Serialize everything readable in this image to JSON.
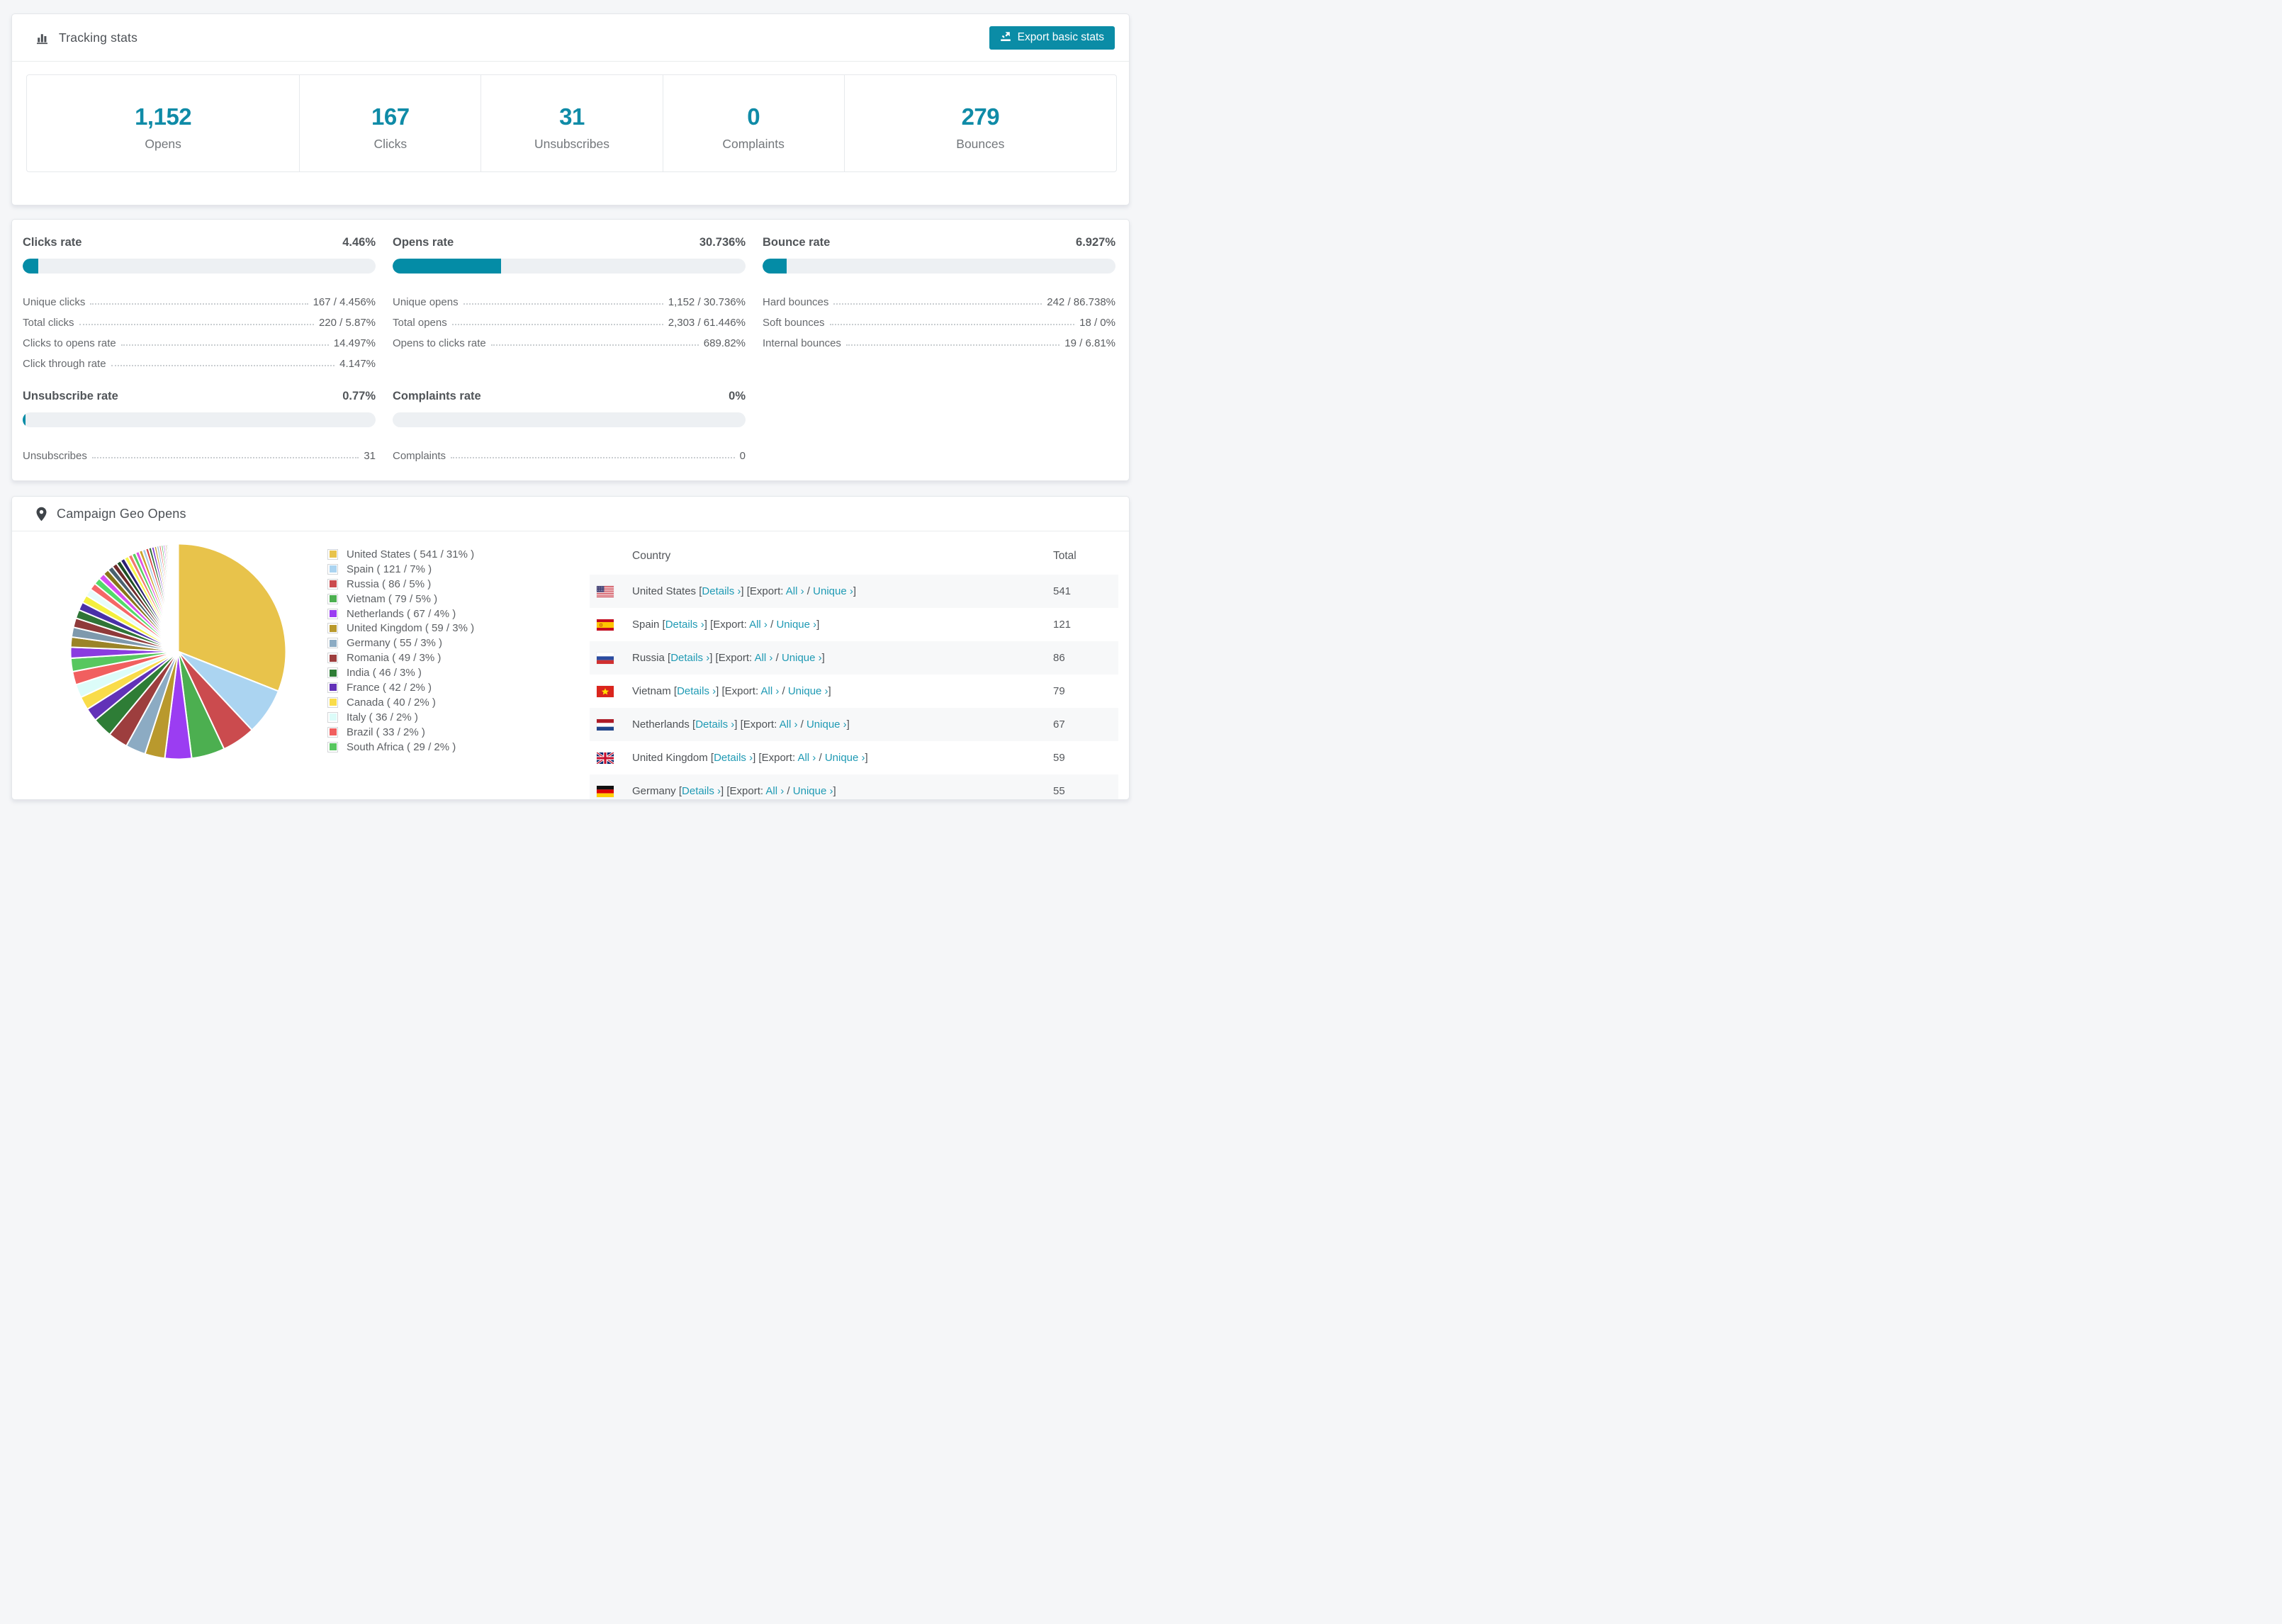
{
  "colors": {
    "accent_teal": "#0b8ca6",
    "stat_number": "#0f8ba7",
    "bar_fill": "#048ca6",
    "bar_track": "#edf0f3",
    "link": "#1f9ab4",
    "row_stripe": "#f7f8f9",
    "card_border": "#e4e7ea",
    "page_bg": "#f5f6f8"
  },
  "tracking_stats": {
    "title": "Tracking stats",
    "export_button_label": "Export basic stats",
    "stats": [
      {
        "value": "1,152",
        "label": "Opens"
      },
      {
        "value": "167",
        "label": "Clicks"
      },
      {
        "value": "31",
        "label": "Unsubscribes"
      },
      {
        "value": "0",
        "label": "Complaints"
      },
      {
        "value": "279",
        "label": "Bounces"
      }
    ]
  },
  "rates": {
    "sections": [
      {
        "title": "Clicks rate",
        "value": "4.46%",
        "pct": 4.46,
        "rows": [
          {
            "label": "Unique clicks",
            "value": "167 / 4.456%"
          },
          {
            "label": "Total clicks",
            "value": "220 / 5.87%"
          },
          {
            "label": "Clicks to opens rate",
            "value": "14.497%"
          },
          {
            "label": "Click through rate",
            "value": "4.147%"
          }
        ]
      },
      {
        "title": "Opens rate",
        "value": "30.736%",
        "pct": 30.736,
        "rows": [
          {
            "label": "Unique opens",
            "value": "1,152 / 30.736%"
          },
          {
            "label": "Total opens",
            "value": "2,303 / 61.446%"
          },
          {
            "label": "Opens to clicks rate",
            "value": "689.82%"
          }
        ]
      },
      {
        "title": "Bounce rate",
        "value": "6.927%",
        "pct": 6.927,
        "rows": [
          {
            "label": "Hard bounces",
            "value": "242 / 86.738%"
          },
          {
            "label": "Soft bounces",
            "value": "18 / 0%"
          },
          {
            "label": "Internal bounces",
            "value": "19 / 6.81%"
          }
        ]
      },
      {
        "title": "Unsubscribe rate",
        "value": "0.77%",
        "pct": 0.77,
        "rows": [
          {
            "label": "Unsubscribes",
            "value": "31"
          }
        ]
      },
      {
        "title": "Complaints rate",
        "value": "0%",
        "pct": 0,
        "rows": [
          {
            "label": "Complaints",
            "value": "0"
          }
        ]
      }
    ]
  },
  "geo": {
    "title": "Campaign Geo Opens",
    "table": {
      "header_country": "Country",
      "header_total": "Total",
      "details_label": "Details ›",
      "export_prefix": "Export:",
      "all_label": "All ›",
      "unique_label": "Unique ›",
      "rows": [
        {
          "country": "United States",
          "flag": "us",
          "total": "541"
        },
        {
          "country": "Spain",
          "flag": "es",
          "total": "121"
        },
        {
          "country": "Russia",
          "flag": "ru",
          "total": "86"
        },
        {
          "country": "Vietnam",
          "flag": "vn",
          "total": "79"
        },
        {
          "country": "Netherlands",
          "flag": "nl",
          "total": "67"
        },
        {
          "country": "United Kingdom",
          "flag": "gb",
          "total": "59"
        },
        {
          "country": "Germany",
          "flag": "de",
          "total": "55"
        }
      ]
    }
  },
  "chart_data": {
    "type": "pie",
    "title": "Campaign Geo Opens",
    "legend_position": "right",
    "legend_format": "{name} ( {value} / {pct}% )",
    "series": [
      {
        "name": "United States",
        "value": 541,
        "pct": 31,
        "color": "#e8c34b"
      },
      {
        "name": "Spain",
        "value": 121,
        "pct": 7,
        "color": "#abd4f1"
      },
      {
        "name": "Russia",
        "value": 86,
        "pct": 5,
        "color": "#cb4b4e"
      },
      {
        "name": "Vietnam",
        "value": 79,
        "pct": 5,
        "color": "#4caf50"
      },
      {
        "name": "Netherlands",
        "value": 67,
        "pct": 4,
        "color": "#9b3df2"
      },
      {
        "name": "United Kingdom",
        "value": 59,
        "pct": 3,
        "color": "#b9992d"
      },
      {
        "name": "Germany",
        "value": 55,
        "pct": 3,
        "color": "#8cabc3"
      },
      {
        "name": "Romania",
        "value": 49,
        "pct": 3,
        "color": "#9d3e3e"
      },
      {
        "name": "India",
        "value": 46,
        "pct": 3,
        "color": "#2e7d36"
      },
      {
        "name": "France",
        "value": 42,
        "pct": 2,
        "color": "#6232b8"
      },
      {
        "name": "Canada",
        "value": 40,
        "pct": 2,
        "color": "#f9dc4a"
      },
      {
        "name": "Italy",
        "value": 36,
        "pct": 2,
        "color": "#dcfcf9"
      },
      {
        "name": "Brazil",
        "value": 33,
        "pct": 2,
        "color": "#f15f5f"
      },
      {
        "name": "South Africa",
        "value": 29,
        "pct": 2,
        "color": "#57c75f"
      }
    ],
    "other_slices_pct_total": 26,
    "other_slices": [
      {
        "w": 1.4,
        "color": "#8a3ce0"
      },
      {
        "w": 1.3,
        "color": "#9b8428"
      },
      {
        "w": 1.25,
        "color": "#7e99ad"
      },
      {
        "w": 1.2,
        "color": "#8f3a3a"
      },
      {
        "w": 1.1,
        "color": "#2f7436"
      },
      {
        "w": 1.05,
        "color": "#4930a8"
      },
      {
        "w": 1.0,
        "color": "#f4ef3e"
      },
      {
        "w": 0.95,
        "color": "#e7fcfa"
      },
      {
        "w": 0.9,
        "color": "#f56767"
      },
      {
        "w": 0.85,
        "color": "#52db69"
      },
      {
        "w": 0.8,
        "color": "#d54ff0"
      },
      {
        "w": 0.75,
        "color": "#877518"
      },
      {
        "w": 0.7,
        "color": "#49616f"
      },
      {
        "w": 0.65,
        "color": "#702c2c"
      },
      {
        "w": 0.6,
        "color": "#1e4f24"
      },
      {
        "w": 0.58,
        "color": "#2b2173"
      },
      {
        "w": 0.55,
        "color": "#f6f649"
      },
      {
        "w": 0.52,
        "color": "#f2776d"
      },
      {
        "w": 0.5,
        "color": "#57d05f"
      },
      {
        "w": 0.48,
        "color": "#e052e0"
      },
      {
        "w": 0.45,
        "color": "#caa22a"
      },
      {
        "w": 0.42,
        "color": "#a9cbe9"
      },
      {
        "w": 0.4,
        "color": "#d84444"
      },
      {
        "w": 0.38,
        "color": "#2f6e3a"
      },
      {
        "w": 0.35,
        "color": "#7b3bd2"
      },
      {
        "w": 0.32,
        "color": "#c9a53a"
      },
      {
        "w": 0.3,
        "color": "#93b9d8"
      },
      {
        "w": 0.28,
        "color": "#ea6363"
      },
      {
        "w": 0.26,
        "color": "#53ba63"
      },
      {
        "w": 0.24,
        "color": "#b254e2"
      },
      {
        "w": 0.22,
        "color": "#97801f"
      },
      {
        "w": 0.2,
        "color": "#62839f"
      },
      {
        "w": 0.18,
        "color": "#8f3232"
      },
      {
        "w": 0.16,
        "color": "#33662f"
      },
      {
        "w": 0.15,
        "color": "#5443a6"
      },
      {
        "w": 0.14,
        "color": "#ecec45"
      },
      {
        "w": 0.13,
        "color": "#f08a80"
      },
      {
        "w": 0.12,
        "color": "#66c285"
      },
      {
        "w": 0.11,
        "color": "#d476d4"
      },
      {
        "w": 0.1,
        "color": "#a39230"
      },
      {
        "w": 0.09,
        "color": "#6b8aa5"
      },
      {
        "w": 0.08,
        "color": "#8f5fd0"
      }
    ]
  }
}
